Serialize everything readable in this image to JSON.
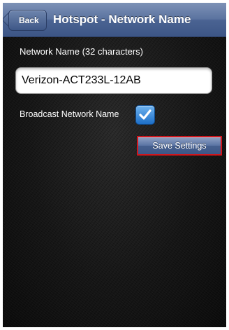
{
  "navbar": {
    "back_label": "Back",
    "title": "Hotspot - Network Name"
  },
  "form": {
    "network_name_label": "Network Name (32 characters)",
    "network_name_value": "Verizon-ACT233L-12AB",
    "broadcast_label": "Broadcast Network Name",
    "broadcast_checked": true,
    "save_label": "Save Settings"
  },
  "colors": {
    "navbar": "#4a6392",
    "checkbox": "#1d6fc8",
    "highlight_border": "#d0161c"
  },
  "icons": {
    "checkbox": "checkmark-icon"
  }
}
